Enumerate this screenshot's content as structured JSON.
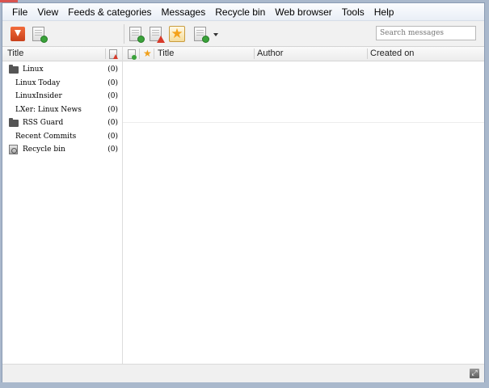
{
  "menubar": {
    "items": [
      "File",
      "View",
      "Feeds & categories",
      "Messages",
      "Recycle bin",
      "Web browser",
      "Tools",
      "Help"
    ]
  },
  "toolbar": {
    "search_placeholder": "Search messages"
  },
  "feeds": {
    "columns": {
      "title": "Title"
    },
    "items": [
      {
        "label": "Linux",
        "count": "(0)",
        "icon": "folder-icon"
      },
      {
        "label": "Linux Today",
        "count": "(0)",
        "icon": ""
      },
      {
        "label": "LinuxInsider",
        "count": "(0)",
        "icon": ""
      },
      {
        "label": "LXer: Linux News",
        "count": "(0)",
        "icon": ""
      },
      {
        "label": "RSS Guard",
        "count": "(0)",
        "icon": "folder-icon"
      },
      {
        "label": "Recent Commits",
        "count": "(0)",
        "icon": ""
      },
      {
        "label": "Recycle bin",
        "count": "(0)",
        "icon": "recycle-bin-icon"
      }
    ]
  },
  "messages": {
    "columns": {
      "title": "Title",
      "author": "Author",
      "created": "Created on"
    }
  },
  "colors": {
    "accent_red": "#d83a2a",
    "accent_green": "#3aa23a",
    "star": "#f4a21a"
  }
}
